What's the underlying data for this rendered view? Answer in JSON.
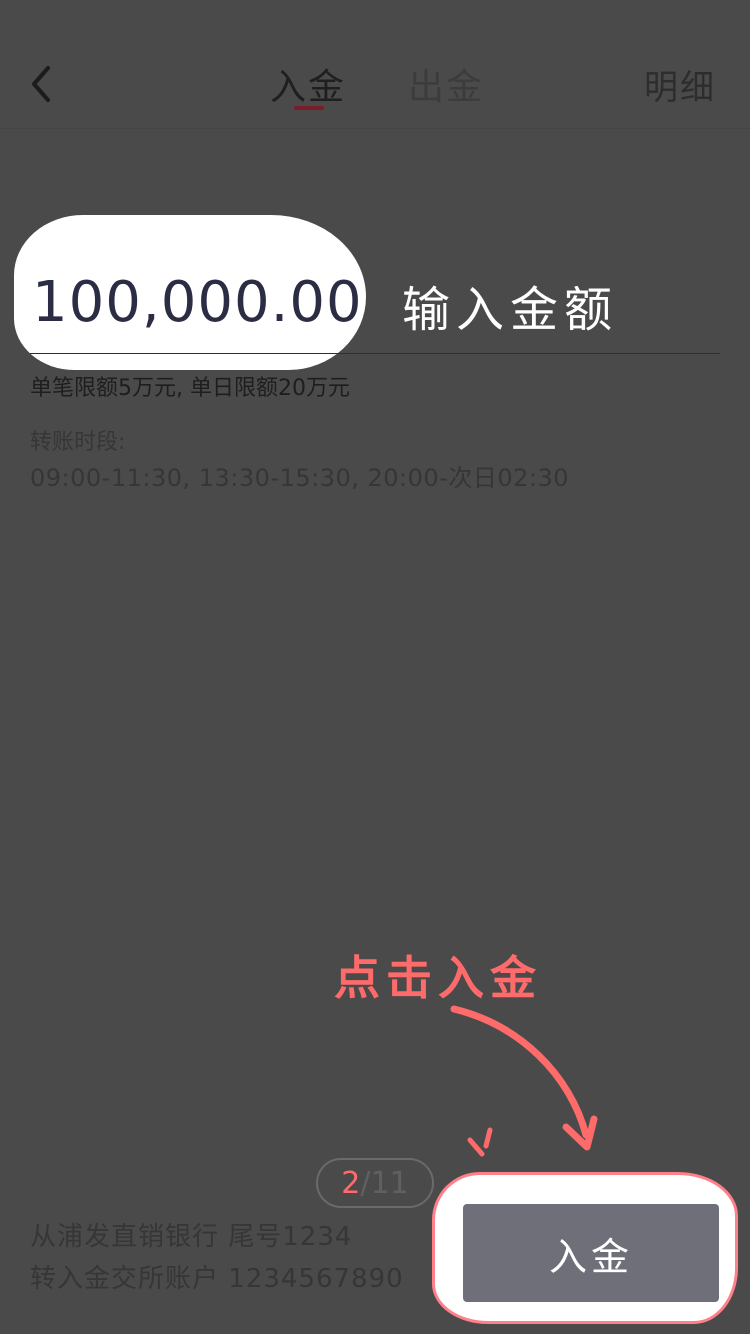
{
  "header": {
    "tabs": [
      {
        "label": "入金",
        "active": true
      },
      {
        "label": "出金",
        "active": false
      }
    ],
    "details_label": "明细"
  },
  "amount": {
    "value": "100,000.00",
    "placeholder": "输入金额"
  },
  "limits": {
    "text": "单笔限额5万元, 单日限额20万元"
  },
  "transfer_time": {
    "label": "转账时段:",
    "value": "09:00-11:30, 13:30-15:30, 20:00-次日02:30"
  },
  "annotation": {
    "text": "点击入金",
    "color": "#ff6b6b"
  },
  "pager": {
    "current": "2",
    "separator": "/",
    "total": "11"
  },
  "account": {
    "from": "从浦发直销银行 尾号1234",
    "to": "转入金交所账户 1234567890"
  },
  "actions": {
    "deposit_label": "入金"
  },
  "colors": {
    "overlay": "#4a4a4a",
    "accent": "#ff6b6b",
    "tab_indicator": "#7a1d28",
    "button": "#6f6f7a"
  },
  "icons": {
    "back": "chevron-left-icon"
  }
}
